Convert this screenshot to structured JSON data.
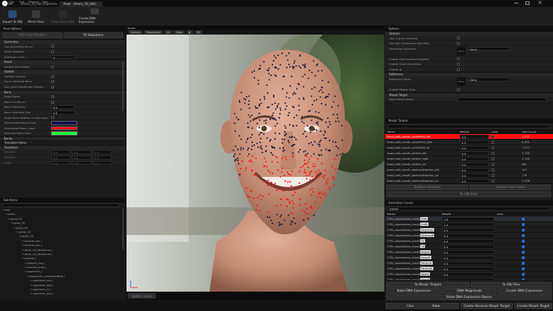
{
  "titlebar": {
    "menu": [
      "File",
      "Edit",
      "Window",
      "Help"
    ],
    "tabs": [
      "Ref",
      "Dmeru_Tst_Add_Expressio...",
      "Poser - Dmeru_Tst_Add..."
    ]
  },
  "toolbar": {
    "buttons": [
      "Export To OBJ",
      "Mirror Pose",
      "Show Base Pose",
      "Create DNA Expression"
    ]
  },
  "pose_options": {
    "header": "Pose Options",
    "add_auto_rotation": "Add Auto Rotation",
    "to_sequence": "To Sequence",
    "symmetry_section": "Symmetry",
    "use_symmetry_mirror": "Use Symmetry Mirror",
    "mirror_rotation": "Mirror Rotation",
    "symmetry_axis_label": "Symmetry Axis",
    "symmetry_axis_value": "X",
    "reset_section": "Reset",
    "update_pose_editor": "Update Pose Editor",
    "update_section": "Update",
    "update_camera": "Update Camera",
    "focus_selected_bone": "Focus Selected Bone",
    "use_local_coordinate": "Use Local Coordinate System",
    "bone_section": "Bone",
    "show_name": "Show Name",
    "bone_size_label": "Bone Full Mirror",
    "bone_thickness_label": "Bone Thickness",
    "bone_thickness_value": "0.0",
    "bone_selection_label": "Bone Selection Size",
    "bone_selection_value": "0.0",
    "draw_bone_rotation": "Draw Bone Rotation In Vieo Now",
    "transform_color": "Transformed Bone Color",
    "unselected_color": "Unselected Bone Color",
    "selected_color": "Selected Bone Color",
    "bones_section": "Bones",
    "transform_section": "Transform Items",
    "transform_header": "Transform",
    "location_label": "Location",
    "rotation_label": "Rotation",
    "scale_label": "Scale",
    "location_values": [
      "0.0",
      "0.0",
      "0.0"
    ],
    "rotation_values": [
      "0.0",
      "0.0",
      "0.0"
    ],
    "scale_values": [
      "1.0",
      "1.0",
      "1.0"
    ]
  },
  "colors": {
    "transform_bone": "#000050",
    "unselected_bone": "#ff1010",
    "selected_bone": "#20ff40",
    "accent_blue": "#2a70d8",
    "selected_row": "#ff1010"
  },
  "skeleton": {
    "header": "Sub Items",
    "search_placeholder": "Search",
    "items": [
      "root",
      "pelvis",
      "spine_01",
      "spine_02",
      "spine_03",
      "spine_04",
      "spine_05",
      "clavicle_pec_l",
      "clavicle_pec_r",
      "spine_04_latissimus_l",
      "spine_04_latissimus_r",
      "clavicle_l",
      "clavicle_out_l",
      "clavicle_scap_l",
      "upperarm_l",
      "upperarm_correctiveRoot_l",
      "upperarm_out_l",
      "upperarm_fwd_l",
      "upperarm_in_l",
      "upperarm_bck_l",
      "clavicle_r",
      "clavicle_out_r",
      "clavicle_scap_r",
      "upperarm_r"
    ]
  },
  "viewport": {
    "label": "Target",
    "options": "Options",
    "perspective": "Perspective",
    "lit": "Lit",
    "show": "Show",
    "fov": "90",
    "update_canvas": "Update Canvas"
  },
  "options_panel": {
    "header": "Options",
    "section_options": "Options",
    "use_current_skeleton": "Use Current Skeleton",
    "use_skel_quaternion": "Use Skel Quaternion Blending",
    "animation_blueprint": "Animation Blueprint",
    "none": "None",
    "enable_post_process": "Enable Post Process Blueprint",
    "enable_cloth": "Enable Cloth Simulation",
    "enable_ik": "Enable IK",
    "section_reference": "Reference",
    "reference_mesh": "Reference Mesh",
    "enable_master_pose": "Enable Master Pose",
    "section_morph": "Morph Target",
    "base_morph_name": "Base Morph Name"
  },
  "morph_targets": {
    "header": "Morph Targets",
    "search_placeholder": "Search",
    "columns": [
      "Name",
      "Weight",
      "Auto",
      "Vert Count"
    ],
    "rows": [
      {
        "name": "head_lod0_mouth_cornerPull_left",
        "weight": "0.0",
        "verts": "7,277"
      },
      {
        "name": "head_lod0_mouth_cornerPull_right",
        "weight": "0.0",
        "verts": "6,505"
      },
      {
        "name": "head_lod0_mouth_cornerPull_ctr",
        "weight": "0.0",
        "verts": "7,777"
      },
      {
        "name": "head_lod0_mouth_stretch_left",
        "weight": "0.0",
        "verts": "2,708"
      },
      {
        "name": "head_lod0_mouth_stretch_right",
        "weight": "0.0",
        "verts": "2,748"
      },
      {
        "name": "head_lod0_mouth_stretch_ctr",
        "weight": "0.0",
        "verts": "687"
      },
      {
        "name": "head_lod0_mouth_lowerLipDepress_left",
        "weight": "0.0",
        "verts": "157"
      },
      {
        "name": "head_lod0_mouth_lowerLipDepress_rgt",
        "weight": "0.0",
        "verts": "176"
      },
      {
        "name": "head_lod0_mouth_lowerLipDepress_ctr",
        "weight": "0.0",
        "verts": "2,106"
      }
    ],
    "to_base_selected": "To Base Selected",
    "update_from_pose": "Update From Pose",
    "to_obj_files": "To OBJ Files"
  },
  "animation_curves": {
    "header": "Animation Curves",
    "search_value": "corner",
    "columns": [
      "Name",
      "Weight",
      "Auto"
    ],
    "rows": [
      {
        "prefix": "CTRL_expressions_mouth",
        "tag": "Pulls",
        "weight": "1.0"
      },
      {
        "prefix": "CTRL_expressions_mouth",
        "tag": "PullR",
        "weight": "1.0"
      },
      {
        "prefix": "CTRL_expressions_mouth",
        "tag": "DepressL",
        "weight": "0.0"
      },
      {
        "prefix": "CTRL_expressions_mouth",
        "tag": "DepressR",
        "weight": "0.0"
      },
      {
        "prefix": "CTRL_expressions_mouth",
        "tag": "SL",
        "weight": "0.0"
      },
      {
        "prefix": "CTRL_expressions_mouth",
        "tag": "SR",
        "weight": "0.0"
      },
      {
        "prefix": "CTRL_expressions_mouth",
        "tag": "DownL",
        "weight": "0.0"
      },
      {
        "prefix": "CTRL_expressions_mouth",
        "tag": "DownR",
        "weight": "0.0"
      },
      {
        "prefix": "CTRL_expressions_mouth",
        "tag": "StretchL",
        "weight": "0.0"
      },
      {
        "prefix": "CTRL_expressions_mouth",
        "tag": "StretchR",
        "weight": "0.0"
      },
      {
        "prefix": "CTRL_expressions_mouth",
        "tag": "WideL",
        "weight": "0.0"
      },
      {
        "prefix": "CTRL_expressions_mouth",
        "tag": "WideR",
        "weight": "0.0"
      }
    ],
    "to_morph_targets": "To Morph Targets",
    "to_obj_files": "To OBJ Files",
    "bake_dna_expression": "Bake DNA Expression",
    "dna_magnitude": "DNA Magnitude",
    "create_dna_expression": "Create DNA Expression",
    "show_dna_bones": "Show DNA Expression Bones"
  },
  "footer": {
    "cancel": "Cancel",
    "bake": "Bake",
    "create_reverse": "Create Reverse Morph Target",
    "create_morph": "Create Morph Target"
  }
}
